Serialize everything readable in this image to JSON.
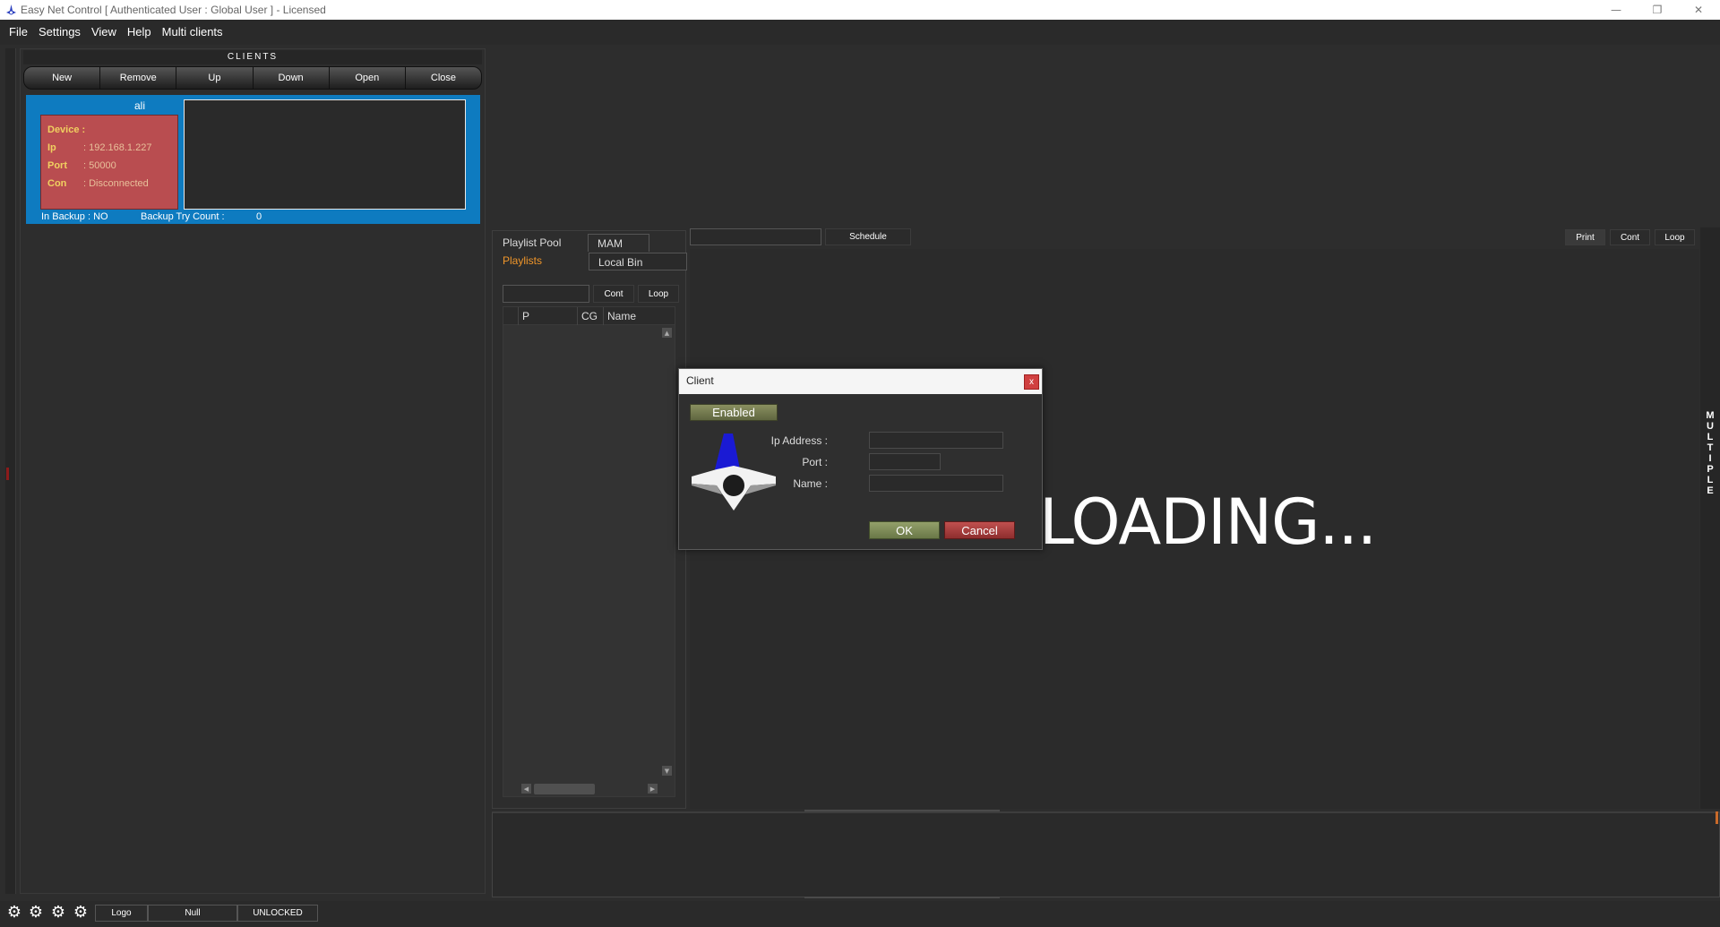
{
  "window": {
    "title": "Easy Net Control  [ Authenticated User : Global User ] - Licensed",
    "minimize_glyph": "—",
    "restore_glyph": "❐",
    "close_glyph": "✕"
  },
  "menu": [
    "File",
    "Settings",
    "View",
    "Help",
    "Multi clients"
  ],
  "clients": {
    "header": "CLIENTS",
    "toolbar": [
      "New",
      "Remove",
      "Up",
      "Down",
      "Open",
      "Close"
    ],
    "card": {
      "name": "ali",
      "device_label": "Device :",
      "ip_label": "Ip",
      "ip_value": ": 192.168.1.227",
      "port_label": "Port",
      "port_value": ": 50000",
      "con_label": "Con",
      "con_value": ": Disconnected",
      "in_backup": "In Backup : NO",
      "backup_try_label": "Backup Try Count :",
      "backup_try_value": "0",
      "card_color": "#0e7bc0",
      "info_color": "#b94d50"
    }
  },
  "playlist": {
    "tabs": {
      "pool": "Playlist Pool",
      "mam": "MAM",
      "playlists": "Playlists",
      "local_bin": "Local Bin"
    },
    "cont": "Cont",
    "loop": "Loop",
    "columns": [
      "P",
      "CG",
      "Name"
    ],
    "active_tab_color": "#f0962a"
  },
  "preview": {
    "schedule": "Schedule",
    "print": "Print",
    "cont": "Cont",
    "loop": "Loop",
    "loading": "LOADING...",
    "side_label": "MULTIPLE"
  },
  "statusbar": {
    "gears": [
      "gear-icon",
      "gear-icon",
      "gear-icon",
      "gear-icon"
    ],
    "logo": "Logo",
    "null": "Null",
    "unlocked": "UNLOCKED"
  },
  "dialog": {
    "title": "Client",
    "close": "x",
    "enabled": "Enabled",
    "ip_label": "Ip Address :",
    "port_label": "Port :",
    "name_label": "Name :",
    "ip_value": "",
    "port_value": "",
    "name_value": "",
    "ok": "OK",
    "cancel": "Cancel"
  }
}
